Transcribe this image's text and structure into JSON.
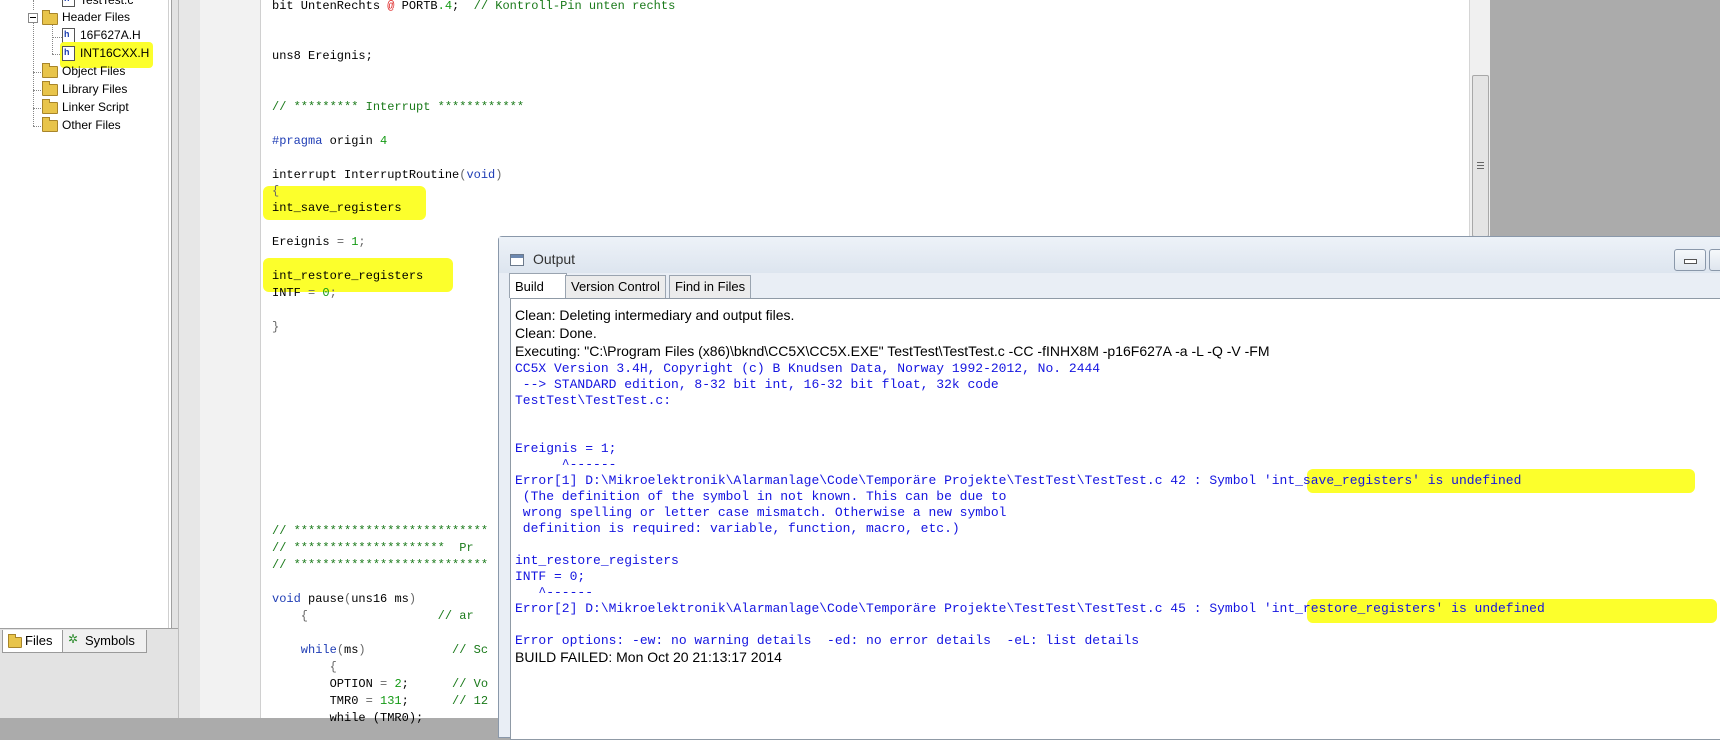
{
  "project_tree": {
    "items": [
      {
        "label": "TestTest.c",
        "type": "file"
      },
      {
        "label": "Header Files",
        "type": "folder-open"
      },
      {
        "label": "16F627A.H",
        "type": "file"
      },
      {
        "label": "INT16CXX.H",
        "type": "file",
        "highlighted": true
      },
      {
        "label": "Object Files",
        "type": "folder"
      },
      {
        "label": "Library Files",
        "type": "folder"
      },
      {
        "label": "Linker Script",
        "type": "folder"
      },
      {
        "label": "Other Files",
        "type": "folder"
      }
    ]
  },
  "left_tabs": {
    "files_label": "Files",
    "symbols_label": "Symbols"
  },
  "editor": {
    "lines": {
      "l1a": "bit UntenRechts ",
      "l1b": "@",
      "l1c": " PORTB",
      "l1d": ".4",
      "l1e": ";  ",
      "l1f": "// Kontroll-Pin unten rechts",
      "l2": "uns8 Ereignis;",
      "l3": "// ********* Interrupt ************",
      "l4a": "#pragma",
      "l4b": " origin ",
      "l4c": "4",
      "l5a": "interrupt InterruptRoutine",
      "l5b": "(",
      "l5c": "void",
      "l5d": ")",
      "l6": "{",
      "l7": "int_save_registers",
      "l8a": "Ereignis ",
      "l8b": "= ",
      "l8c": "1",
      "l8d": ";",
      "l9": "int_restore_registers",
      "l10a": "INTF ",
      "l10b": "= ",
      "l10c": "0",
      "l10d": ";",
      "l11": "}",
      "l12": "// ***************************",
      "l13a": "// *********************  ",
      "l13b": "Pr",
      "l14": "// ***************************",
      "l15a": "void",
      "l15b": " pause",
      "l15c": "(",
      "l15d": "uns16 ms",
      "l15e": ")",
      "l16a": "    {",
      "l16b": "                  // ar",
      "l17a": "    while",
      "l17b": "(",
      "l17c": "ms",
      "l17d": ")",
      "l17e": "            // Sc",
      "l18": "        {",
      "l19a": "        OPTION ",
      "l19b": "= ",
      "l19c": "2",
      "l19d": ";",
      "l19e": "      // Vo",
      "l20a": "        TMR0 ",
      "l20b": "= ",
      "l20c": "131",
      "l20d": ";",
      "l20e": "      // 12",
      "l21": "        while (TMR0);"
    }
  },
  "output": {
    "title": "Output",
    "tabs": [
      "Build",
      "Version Control",
      "Find in Files"
    ],
    "active_tab": "Build",
    "lines": [
      {
        "text": "Clean: Deleting intermediary and output files.",
        "style": "plain"
      },
      {
        "text": "Clean: Done.",
        "style": "plain"
      },
      {
        "text": "Executing: \"C:\\Program Files (x86)\\bknd\\CC5X\\CC5X.EXE\" TestTest\\TestTest.c -CC -fINHX8M -p16F627A -a -L -Q -V -FM",
        "style": "plain"
      },
      {
        "text": "CC5X Version 3.4H, Copyright (c) B Knudsen Data, Norway 1992-2012, No. 2444",
        "style": "blue"
      },
      {
        "text": " --> STANDARD edition, 8-32 bit int, 16-32 bit float, 32k code",
        "style": "blue"
      },
      {
        "text": "TestTest\\TestTest.c:",
        "style": "blue"
      },
      {
        "text": "Ereignis = 1;",
        "style": "blue"
      },
      {
        "text": "      ^------",
        "style": "blue"
      },
      {
        "text": "Error[1] D:\\Mikroelektronik\\Alarmanlage\\Code\\Temporäre Projekte\\TestTest\\TestTest.c 42 : Symbol 'int_save_registers' is undefined",
        "style": "blue"
      },
      {
        "text": " (The definition of the symbol in not known. This can be due to",
        "style": "blue"
      },
      {
        "text": " wrong spelling or letter case mismatch. Otherwise a new symbol",
        "style": "blue"
      },
      {
        "text": " definition is required: variable, function, macro, etc.)",
        "style": "blue"
      },
      {
        "text": "int_restore_registers",
        "style": "blue"
      },
      {
        "text": "INTF = 0;",
        "style": "blue"
      },
      {
        "text": "   ^------",
        "style": "blue"
      },
      {
        "text": "Error[2] D:\\Mikroelektronik\\Alarmanlage\\Code\\Temporäre Projekte\\TestTest\\TestTest.c 45 : Symbol 'int_restore_registers' is undefined",
        "style": "blue"
      },
      {
        "text": "Error options: -ew: no warning details  -ed: no error details  -eL: list details",
        "style": "blue"
      },
      {
        "text": "BUILD FAILED: Mon Oct 20 21:13:17 2014",
        "style": "plain"
      }
    ]
  },
  "colors": {
    "highlight": "#fcff2c",
    "keyword": "#1f3db5",
    "number": "#159a15",
    "output_blue": "#1414e0"
  }
}
